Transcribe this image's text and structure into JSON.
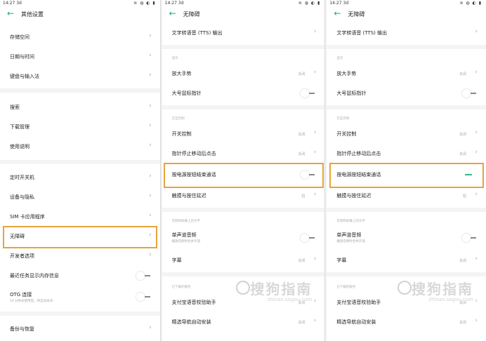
{
  "panel1": {
    "status": {
      "time": "14:27 3d",
      "sys": "≋ ◍ ◐ ▮"
    },
    "title": "其他设置",
    "back_icon": "←",
    "items": [
      {
        "label": "存储空间"
      },
      {
        "label": "日期与时间"
      },
      {
        "label": "键盘与输入法"
      },
      {
        "label": "搜索"
      },
      {
        "label": "下载管理"
      },
      {
        "label": "使用说明"
      },
      {
        "label": "定时开关机"
      },
      {
        "label": "设备与隐私"
      },
      {
        "label": "SIM 卡应用程序"
      },
      {
        "label": "无障碍"
      },
      {
        "label": "开发者选项"
      },
      {
        "label": "最近任务显示内存信息"
      },
      {
        "label": "OTG 连接",
        "sub": "10 分钟未使用后，将自动关闭"
      },
      {
        "label": "备份与恢复"
      }
    ]
  },
  "panel2": {
    "status": {
      "time": "14:27 3d",
      "sys": "≋ ◍ ◐ ▮"
    },
    "title": "无障碍",
    "back_icon": "←",
    "tts": "文字转语音 (TTS) 输出",
    "sec_display": "显示",
    "magnify": {
      "label": "放大手势",
      "value": "关闭"
    },
    "bigcursor": {
      "label": "大号鼠标指针"
    },
    "sec_interact": "交互控制",
    "switch_ctrl": {
      "label": "开关控制",
      "value": "关闭"
    },
    "dwell": {
      "label": "指针停止移动后点击",
      "value": "关闭"
    },
    "power_end": {
      "label": "按电源按钮结束通话"
    },
    "touch_delay": {
      "label": "触摸与按住延迟",
      "value": "短"
    },
    "sec_audio": "音频和屏幕上的文字",
    "mono": {
      "label": "单声道音频",
      "sub": "播放音频时合并声道"
    },
    "captions": {
      "label": "字幕",
      "value": "关闭"
    },
    "sec_services": "已下载的服务",
    "alipay": {
      "label": "支付宝语音校验助手",
      "value": "关闭"
    },
    "nav": {
      "label": "精选导航自动安装",
      "value": "关闭"
    },
    "watermark": {
      "text": "搜狗指南",
      "url": "zhinan.sogou.com"
    }
  },
  "panel3": {
    "status": {
      "time": "14:27 3d",
      "sys": "≋ ◍ ◐ ▮"
    },
    "title": "无障碍",
    "back_icon": "←",
    "tts": "文字转语音 (TTS) 输出",
    "sec_display": "显示",
    "magnify": {
      "label": "放大手势",
      "value": "关闭"
    },
    "bigcursor": {
      "label": "大号鼠标指针"
    },
    "sec_interact": "交互控制",
    "switch_ctrl": {
      "label": "开关控制",
      "value": "关闭"
    },
    "dwell": {
      "label": "指针停止移动后点击",
      "value": "关闭"
    },
    "power_end": {
      "label": "按电源按钮结束通话",
      "state": "on"
    },
    "touch_delay": {
      "label": "触摸与按住延迟",
      "value": "短"
    },
    "sec_audio": "音频和屏幕上的文字",
    "mono": {
      "label": "单声道音频",
      "sub": "播放音频时合并声道"
    },
    "captions": {
      "label": "字幕",
      "value": "关闭"
    },
    "sec_services": "已下载的服务",
    "alipay": {
      "label": "支付宝语音校验助手",
      "value": "关闭"
    },
    "nav": {
      "label": "精选导航自动安装",
      "value": "关闭"
    },
    "watermark": {
      "text": "搜狗指南",
      "url": "zhinan.sogou.com"
    }
  },
  "colors": {
    "accent": "#1aa77c",
    "highlight": "#e8a33d",
    "toggle_on": "#2cbf86"
  }
}
